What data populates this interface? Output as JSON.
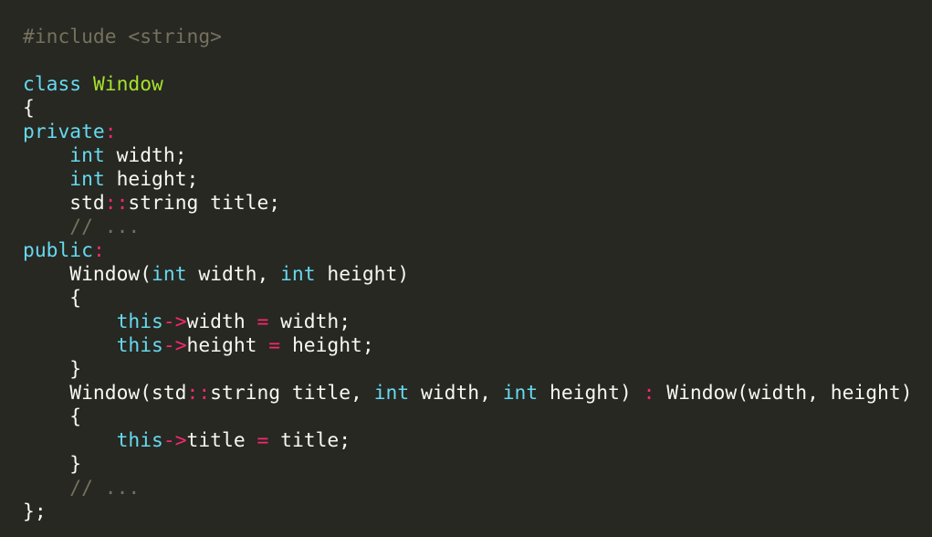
{
  "colors": {
    "background": "#272822",
    "plain": "#f8f8f2",
    "preproc": "#75715e",
    "comment": "#75715e",
    "keyword": "#66d9ef",
    "type": "#66d9ef",
    "classname": "#a6e22e",
    "operator": "#f92672"
  },
  "code": {
    "lines": [
      [
        [
          "preproc",
          "#include <string>"
        ]
      ],
      [],
      [
        [
          "keyword",
          "class"
        ],
        [
          "plain",
          " "
        ],
        [
          "classname",
          "Window"
        ]
      ],
      [
        [
          "plain",
          "{"
        ]
      ],
      [
        [
          "keyword",
          "private"
        ],
        [
          "op",
          ":"
        ]
      ],
      [
        [
          "plain",
          "    "
        ],
        [
          "type",
          "int"
        ],
        [
          "plain",
          " width;"
        ]
      ],
      [
        [
          "plain",
          "    "
        ],
        [
          "type",
          "int"
        ],
        [
          "plain",
          " height;"
        ]
      ],
      [
        [
          "plain",
          "    std"
        ],
        [
          "op",
          "::"
        ],
        [
          "plain",
          "string title;"
        ]
      ],
      [
        [
          "plain",
          "    "
        ],
        [
          "comment",
          "// ..."
        ]
      ],
      [
        [
          "keyword",
          "public"
        ],
        [
          "op",
          ":"
        ]
      ],
      [
        [
          "plain",
          "    Window("
        ],
        [
          "type",
          "int"
        ],
        [
          "plain",
          " width, "
        ],
        [
          "type",
          "int"
        ],
        [
          "plain",
          " height)"
        ]
      ],
      [
        [
          "plain",
          "    {"
        ]
      ],
      [
        [
          "plain",
          "        "
        ],
        [
          "keyword",
          "this"
        ],
        [
          "op",
          "->"
        ],
        [
          "plain",
          "width "
        ],
        [
          "op",
          "="
        ],
        [
          "plain",
          " width;"
        ]
      ],
      [
        [
          "plain",
          "        "
        ],
        [
          "keyword",
          "this"
        ],
        [
          "op",
          "->"
        ],
        [
          "plain",
          "height "
        ],
        [
          "op",
          "="
        ],
        [
          "plain",
          " height;"
        ]
      ],
      [
        [
          "plain",
          "    }"
        ]
      ],
      [
        [
          "plain",
          "    Window(std"
        ],
        [
          "op",
          "::"
        ],
        [
          "plain",
          "string title, "
        ],
        [
          "type",
          "int"
        ],
        [
          "plain",
          " width, "
        ],
        [
          "type",
          "int"
        ],
        [
          "plain",
          " height) "
        ],
        [
          "op",
          ":"
        ],
        [
          "plain",
          " Window(width, height)"
        ]
      ],
      [
        [
          "plain",
          "    {"
        ]
      ],
      [
        [
          "plain",
          "        "
        ],
        [
          "keyword",
          "this"
        ],
        [
          "op",
          "->"
        ],
        [
          "plain",
          "title "
        ],
        [
          "op",
          "="
        ],
        [
          "plain",
          " title;"
        ]
      ],
      [
        [
          "plain",
          "    }"
        ]
      ],
      [
        [
          "plain",
          "    "
        ],
        [
          "comment",
          "// ..."
        ]
      ],
      [
        [
          "plain",
          "};"
        ]
      ]
    ]
  }
}
